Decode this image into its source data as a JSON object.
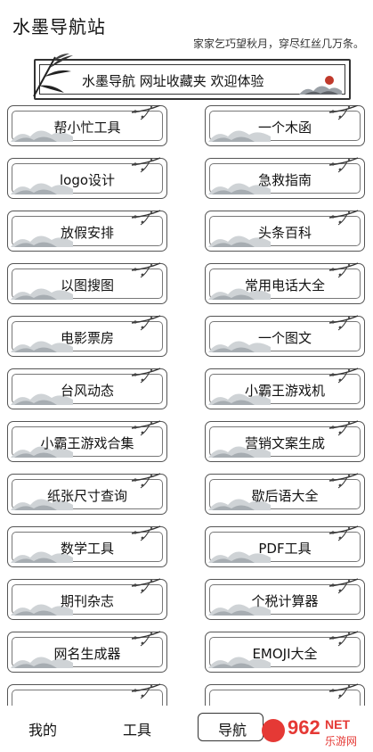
{
  "header": {
    "title": "水墨导航站",
    "tagline": "家家乞巧望秋月，穿尽红丝几万条。"
  },
  "banner": {
    "text": "水墨导航 网址收藏夹 欢迎体验"
  },
  "tools": [
    [
      "帮小忙工具",
      "一个木函"
    ],
    [
      "logo设计",
      "急救指南"
    ],
    [
      "放假安排",
      "头条百科"
    ],
    [
      "以图搜图",
      "常用电话大全"
    ],
    [
      "电影票房",
      "一个图文"
    ],
    [
      "台风动态",
      "小霸王游戏机"
    ],
    [
      "小霸王游戏合集",
      "营销文案生成"
    ],
    [
      "纸张尺寸查询",
      "歇后语大全"
    ],
    [
      "数学工具",
      "PDF工具"
    ],
    [
      "期刊杂志",
      "个税计算器"
    ],
    [
      "网名生成器",
      "EMOJI大全"
    ],
    [
      "",
      ""
    ]
  ],
  "nav": {
    "mine": "我的",
    "tools": "工具",
    "navigation": "导航"
  },
  "watermark": {
    "brand": "962",
    "suffix": "NET",
    "sub": "乐游网"
  }
}
